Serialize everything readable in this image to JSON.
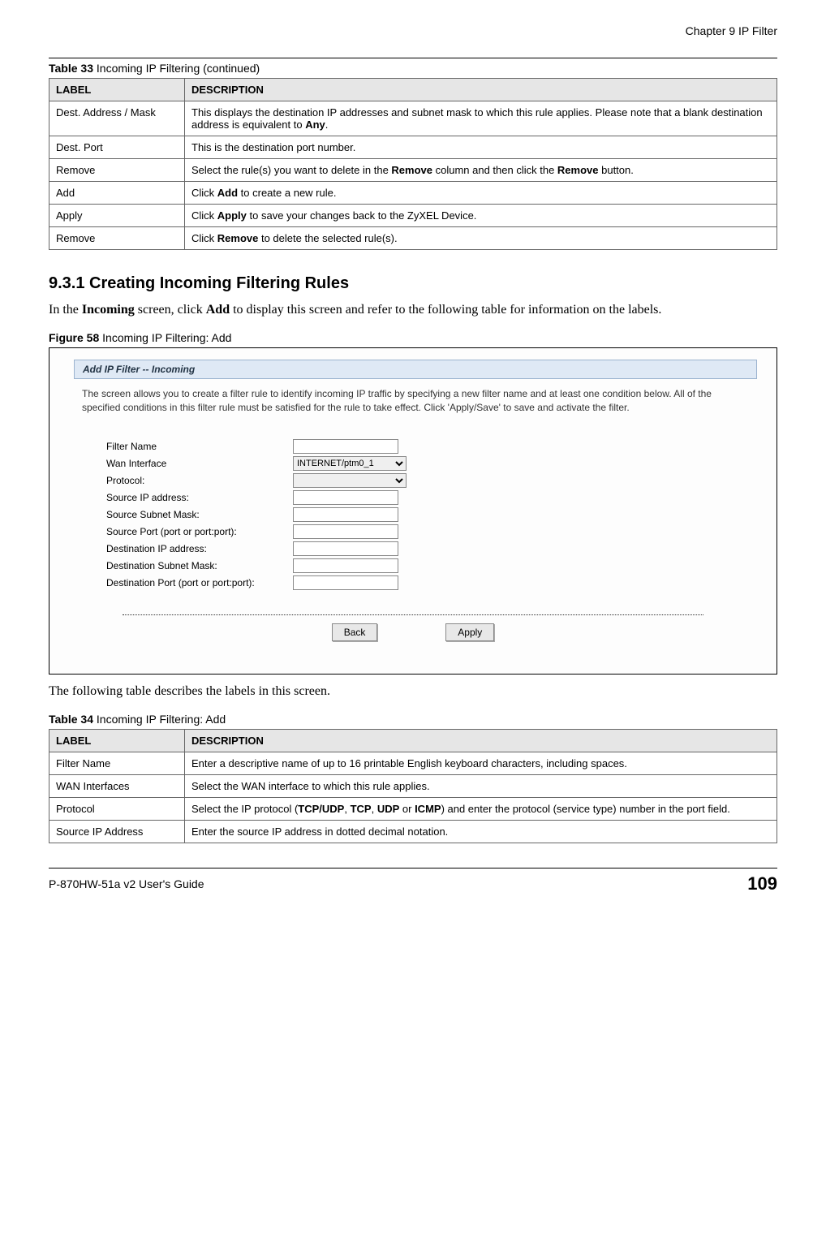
{
  "header": {
    "chapter": "Chapter 9 IP Filter"
  },
  "table33": {
    "caption_bold": "Table 33",
    "caption_rest": "   Incoming IP Filtering (continued)",
    "headers": {
      "label": "LABEL",
      "desc": "DESCRIPTION"
    },
    "rows": [
      {
        "label": "Dest. Address / Mask",
        "desc_pre": "This displays the destination IP addresses and subnet mask to which this rule applies. Please note that a blank destination address is equivalent to ",
        "desc_bold": "Any",
        "desc_post": "."
      },
      {
        "label": "Dest. Port",
        "desc_pre": "This is the destination port number.",
        "desc_bold": "",
        "desc_post": ""
      },
      {
        "label": "Remove",
        "desc_pre": "Select the rule(s) you want to delete in the ",
        "desc_bold": "Remove",
        "desc_mid": " column and then click the ",
        "desc_bold2": "Remove",
        "desc_post": " button."
      },
      {
        "label": "Add",
        "desc_pre": "Click ",
        "desc_bold": "Add",
        "desc_post": " to create a new rule."
      },
      {
        "label": "Apply",
        "desc_pre": "Click ",
        "desc_bold": "Apply",
        "desc_post": " to save your changes back to the ZyXEL Device."
      },
      {
        "label": "Remove",
        "desc_pre": "Click ",
        "desc_bold": "Remove",
        "desc_post": " to delete the selected rule(s)."
      }
    ]
  },
  "section": {
    "heading": "9.3.1  Creating Incoming Filtering Rules",
    "intro_pre": "In the ",
    "intro_b1": "Incoming",
    "intro_mid": " screen, click ",
    "intro_b2": "Add",
    "intro_post": " to display this screen and refer to the following table for information on the labels."
  },
  "figure": {
    "caption_bold": "Figure 58",
    "caption_rest": "   Incoming IP Filtering: Add",
    "panel_title": "Add IP Filter -- Incoming",
    "panel_intro": "The screen allows you to create a filter rule to identify incoming IP traffic by specifying a new filter name and at least one condition below. All of the specified conditions in this filter rule must be satisfied for the rule to take effect. Click 'Apply/Save' to save and activate the filter.",
    "fields": {
      "filter_name": "Filter Name",
      "wan_interface": "Wan Interface",
      "protocol": "Protocol:",
      "src_ip": "Source IP address:",
      "src_mask": "Source Subnet Mask:",
      "src_port": "Source Port (port or port:port):",
      "dst_ip": "Destination IP address:",
      "dst_mask": "Destination Subnet Mask:",
      "dst_port": "Destination Port (port or port:port):"
    },
    "wan_option": "INTERNET/ptm0_1",
    "protocol_option": "",
    "buttons": {
      "back": "Back",
      "apply": "Apply"
    }
  },
  "after_figure": {
    "text": "The following table describes the labels in this screen."
  },
  "table34": {
    "caption_bold": "Table 34",
    "caption_rest": "   Incoming IP Filtering: Add",
    "headers": {
      "label": "LABEL",
      "desc": "DESCRIPTION"
    },
    "rows": [
      {
        "label": "Filter Name",
        "desc": "Enter a descriptive name of up to 16 printable English keyboard characters, including spaces."
      },
      {
        "label": "WAN Interfaces",
        "desc": "Select the WAN interface to which this rule applies."
      },
      {
        "label": "Protocol",
        "desc_pre": "Select the IP protocol (",
        "b1": "TCP/UDP",
        "s1": ", ",
        "b2": "TCP",
        "s2": ", ",
        "b3": "UDP",
        "s3": " or ",
        "b4": "ICMP",
        "desc_post": ") and enter the protocol (service type) number in the port field."
      },
      {
        "label": "Source IP Address",
        "desc": "Enter the source IP address in dotted decimal notation."
      }
    ]
  },
  "footer": {
    "guide": "P-870HW-51a v2 User's Guide",
    "page": "109"
  }
}
